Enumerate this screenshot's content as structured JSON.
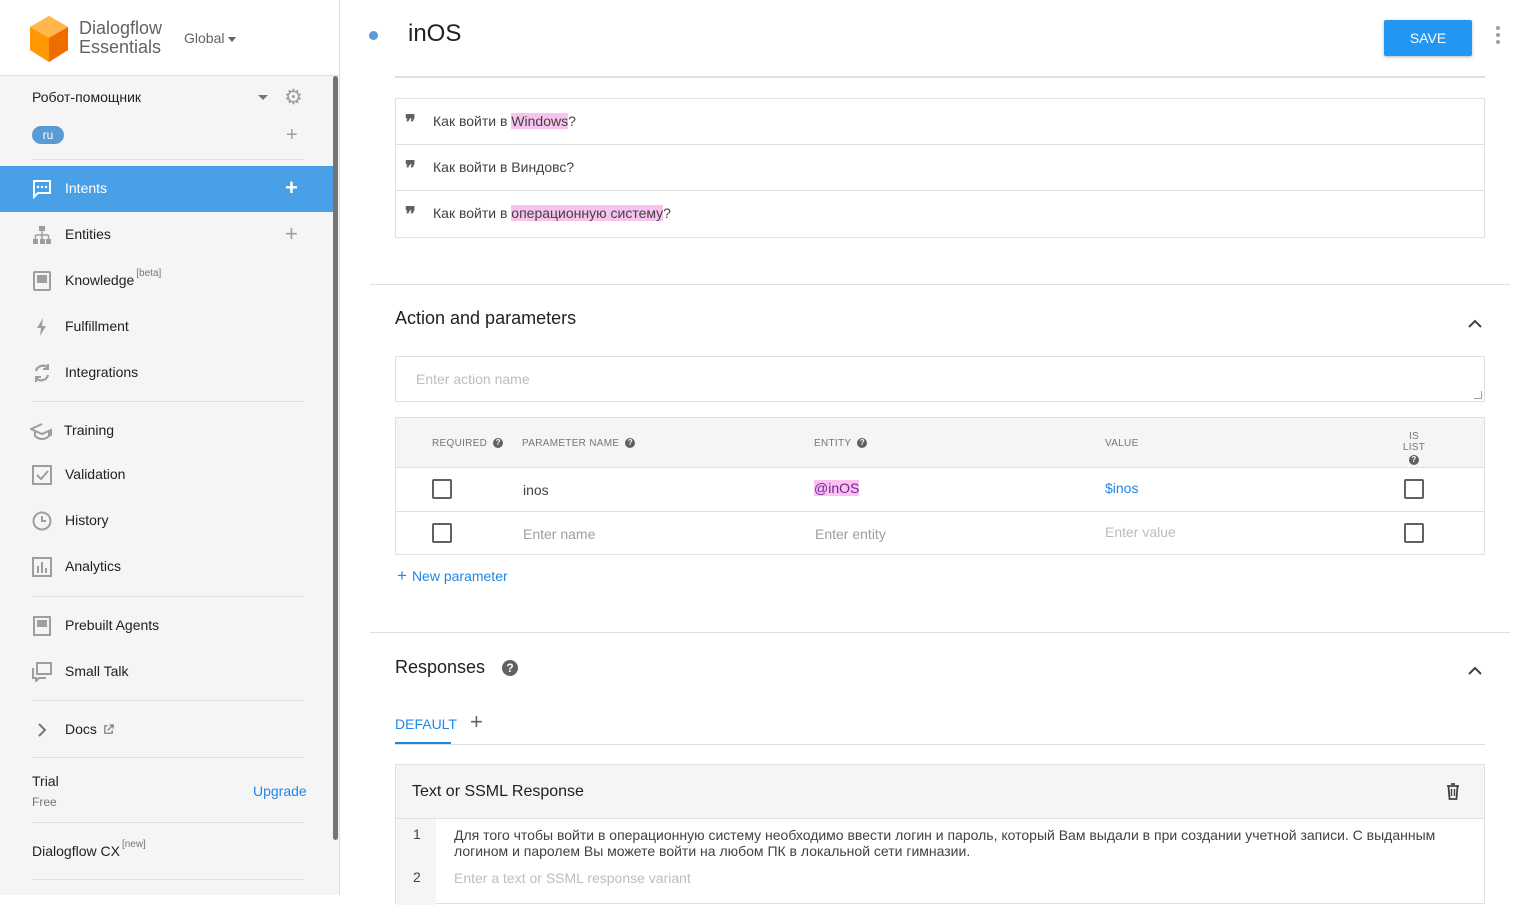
{
  "app": {
    "logo_line1": "Dialogflow",
    "logo_line2": "Essentials",
    "region": "Global"
  },
  "agent": {
    "name": "Робот-помощник",
    "language": "ru"
  },
  "nav": {
    "intents": "Intents",
    "entities": "Entities",
    "knowledge": "Knowledge",
    "knowledge_tag": "[beta]",
    "fulfillment": "Fulfillment",
    "integrations": "Integrations",
    "training": "Training",
    "validation": "Validation",
    "history": "History",
    "analytics": "Analytics",
    "prebuilt_agents": "Prebuilt Agents",
    "small_talk": "Small Talk",
    "docs": "Docs"
  },
  "plan": {
    "name": "Trial",
    "tier": "Free",
    "upgrade": "Upgrade",
    "cx_label": "Dialogflow CX",
    "cx_tag": "[new]"
  },
  "header": {
    "title": "inOS",
    "save": "SAVE"
  },
  "training_phrases": [
    {
      "before": "Как войти в ",
      "highlight": "Windows",
      "after": "?"
    },
    {
      "before": "Как войти в Виндовс?",
      "highlight": "",
      "after": ""
    },
    {
      "before": "Как войти в ",
      "highlight": "операционную систему",
      "after": "?"
    }
  ],
  "action": {
    "section_title": "Action and parameters",
    "placeholder": "Enter action name"
  },
  "params_table": {
    "headers": {
      "required": "REQUIRED",
      "name": "PARAMETER NAME",
      "entity": "ENTITY",
      "value": "VALUE",
      "is_list": "IS LIST"
    },
    "rows": [
      {
        "name": "inos",
        "entity": "@inOS",
        "value": "$inos",
        "required": false,
        "is_list": false
      }
    ],
    "empty_row": {
      "name_placeholder": "Enter name",
      "entity_placeholder": "Enter entity",
      "value_placeholder": "Enter value"
    },
    "new_parameter": "New parameter"
  },
  "responses": {
    "section_title": "Responses",
    "tab_default": "DEFAULT",
    "card_title": "Text or SSML Response",
    "lines": [
      {
        "num": "1",
        "text": "Для того чтобы войти в операционную систему необходимо ввести логин и пароль, который Вам выдали в при создании учетной записи. С выданным логином и паролем Вы можете войти на любом ПК в локальной сети гимназии."
      },
      {
        "num": "2",
        "placeholder": "Enter a text or SSML response variant"
      }
    ]
  },
  "colors": {
    "accent": "#2196f3",
    "active_nav": "#4aa0e6",
    "entity_highlight": "#f8c3ef",
    "link": "#1e88e5"
  }
}
